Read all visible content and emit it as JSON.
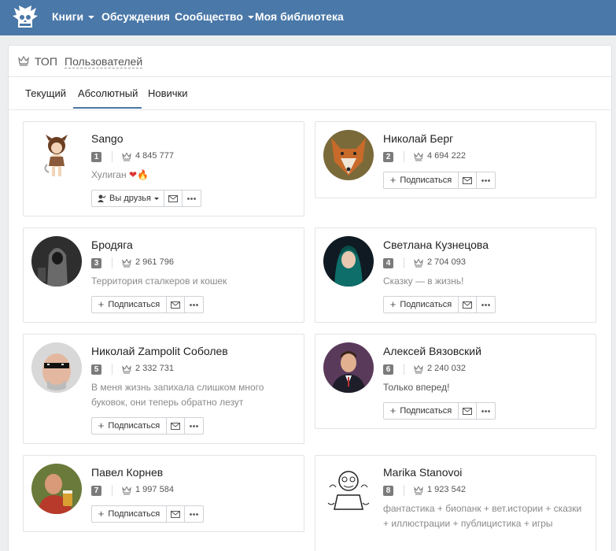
{
  "nav": {
    "logo_icon": "owl-logo-icon",
    "items": [
      {
        "label": "Книги",
        "has_dropdown": true
      },
      {
        "label": "Обсуждения",
        "has_dropdown": false
      },
      {
        "label": "Сообщество",
        "has_dropdown": true
      },
      {
        "label": "Моя библиотека",
        "has_dropdown": false
      }
    ]
  },
  "header": {
    "title": "ТОП",
    "link": "Пользователей",
    "icon": "crown-icon"
  },
  "tabs": [
    {
      "label": "Текущий",
      "active": false
    },
    {
      "label": "Абсолютный",
      "active": true
    },
    {
      "label": "Новички",
      "active": false
    }
  ],
  "buttons": {
    "subscribe": "Подписаться",
    "friends": "Вы друзья"
  },
  "users": [
    {
      "name": "Sango",
      "rank": "1",
      "score": "4 845 777",
      "status": "Хулиган",
      "status_emojis": "❤🔥",
      "button": "Вы друзья"
    },
    {
      "name": "Николай Берг",
      "rank": "2",
      "score": "4 694 222",
      "status": "",
      "button": "Подписаться"
    },
    {
      "name": "Бродяга",
      "rank": "3",
      "score": "2 961 796",
      "status": "Территория сталкеров и кошек",
      "button": "Подписаться"
    },
    {
      "name": "Светлана Кузнецова",
      "rank": "4",
      "score": "2 704 093",
      "status": "Сказку — в жизнь!",
      "button": "Подписаться"
    },
    {
      "name": "Николай Zampolit Соболев",
      "rank": "5",
      "score": "2 332 731",
      "status": "В меня жизнь запихала слишком много буковок, они теперь обратно лезут",
      "button": "Подписаться"
    },
    {
      "name": "Алексей Вязовский",
      "rank": "6",
      "score": "2 240 032",
      "status": "Только вперед!",
      "button": "Подписаться"
    },
    {
      "name": "Павел Корнев",
      "rank": "7",
      "score": "1 997 584",
      "status": "",
      "button": "Подписаться"
    },
    {
      "name": "Marika Stanovoi",
      "rank": "8",
      "score": "1 923 542",
      "status": "фантастика + биопанк + вет.истории + сказки + иллюстрации + публицистика + игры",
      "button": ""
    }
  ],
  "colors": {
    "nav_bg": "#4a78a8",
    "accent": "#4a78a8",
    "rank_bg": "#7b7b7b"
  }
}
